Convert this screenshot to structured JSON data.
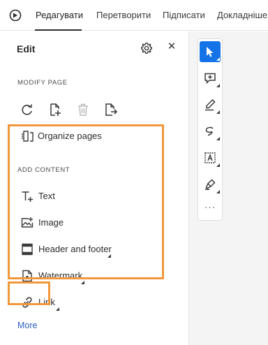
{
  "tabs": [
    {
      "label": "Редагувати",
      "active": true
    },
    {
      "label": "Перетворити",
      "active": false
    },
    {
      "label": "Підписати",
      "active": false
    },
    {
      "label": "Докладніше",
      "active": false
    }
  ],
  "panel": {
    "title": "Edit",
    "modify_section": "MODIFY PAGE",
    "page_tools": [
      "rotate-icon",
      "insert-pages-icon",
      "delete-page-icon",
      "extract-pages-icon"
    ],
    "organize_label": "Organize pages",
    "add_section": "ADD CONTENT",
    "items": [
      {
        "label": "Text",
        "icon": "add-text-icon"
      },
      {
        "label": "Image",
        "icon": "add-image-icon"
      },
      {
        "label": "Header and footer",
        "icon": "header-footer-icon"
      },
      {
        "label": "Watermark",
        "icon": "watermark-icon"
      },
      {
        "label": "Link",
        "icon": "link-icon"
      }
    ],
    "more_label": "More"
  },
  "toolbar": {
    "tools": [
      "select-cursor-icon",
      "add-comment-icon",
      "highlight-pen-icon",
      "draw-freeform-icon",
      "text-box-icon",
      "signature-icon"
    ],
    "overflow": "···"
  },
  "colors": {
    "highlight_box": "#f0983a",
    "selected_tool": "#1473e6",
    "link": "#2a5fc1"
  }
}
